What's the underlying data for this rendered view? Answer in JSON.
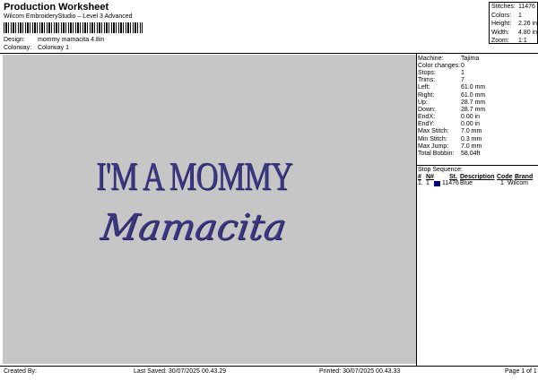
{
  "header": {
    "title": "Production Worksheet",
    "subtitle": "Wilcom EmbroideryStudio – Level 3 Advanced"
  },
  "meta": {
    "design_label": "Design:",
    "design_value": "mommy mamacita 4.8in",
    "colorway_label": "Colorway:",
    "colorway_value": "Colorway 1"
  },
  "stats": [
    {
      "label": "Stitches:",
      "value": "11476"
    },
    {
      "label": "Colors:",
      "value": "1"
    },
    {
      "label": "Height:",
      "value": "2.26 in"
    },
    {
      "label": "Width:",
      "value": "4.80 in"
    },
    {
      "label": "Zoom:",
      "value": "1:1"
    }
  ],
  "design_text": {
    "line1": "I'M A MOMMY",
    "line2": "Mamacita"
  },
  "info": [
    {
      "label": "Machine:",
      "value": "Tajima"
    },
    {
      "label": "Color changes:",
      "value": "0"
    },
    {
      "label": "Stops:",
      "value": "1"
    },
    {
      "label": "Trims:",
      "value": "7"
    },
    {
      "label": "Left:",
      "value": "61.0 mm"
    },
    {
      "label": "Right:",
      "value": "61.0 mm"
    },
    {
      "label": "Up:",
      "value": "28.7 mm"
    },
    {
      "label": "Down:",
      "value": "28.7 mm"
    },
    {
      "label": "EndX:",
      "value": "0.00 in"
    },
    {
      "label": "EndY:",
      "value": "0.00 in"
    },
    {
      "label": "Max Stitch:",
      "value": "7.0 mm"
    },
    {
      "label": "Min Stitch:",
      "value": "0.3 mm"
    },
    {
      "label": "Max Jump:",
      "value": "7.0 mm"
    },
    {
      "label": "Total Bobbin:",
      "value": "58.04ft"
    }
  ],
  "stop_sequence": {
    "title": "Stop Sequence:",
    "headers": {
      "n": "#",
      "n2": "N#",
      "st": "St.",
      "desc": "Description",
      "code": "Code",
      "brand": "Brand"
    },
    "row": {
      "idx": "1.",
      "n": "1",
      "st": "11476",
      "desc": "Blue",
      "code": "1",
      "brand": "Wilcom"
    },
    "swatch_color": "#000080"
  },
  "footer": {
    "created": "Created By:",
    "saved": "Last Saved: 30/07/2025 00.43.29",
    "printed": "Printed: 30/07/2025 00.43.33",
    "page": "Page 1 of 1"
  },
  "colors": {
    "thread": "#3b3780",
    "background": "#c6c6c6"
  }
}
